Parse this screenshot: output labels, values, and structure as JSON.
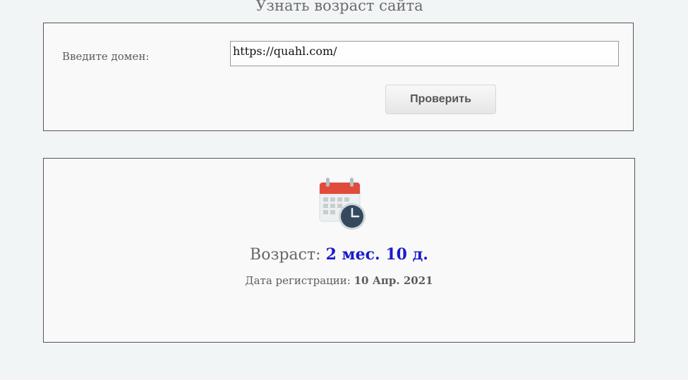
{
  "header": {
    "title": "Узнать возраст сайта"
  },
  "form": {
    "domain_label": "Введите домен:",
    "domain_value": "https://quahl.com/",
    "submit_label": "Проверить"
  },
  "result": {
    "icon": "calendar-clock-icon",
    "age_label": "Возраст:",
    "age_value": "2 мес. 10 д.",
    "registration_label": "Дата регистрации:",
    "registration_value": "10 Апр. 2021"
  },
  "colors": {
    "age_value": "#1a1acc",
    "calendar_header": "#e14b3c",
    "clock_face": "#34495e"
  }
}
